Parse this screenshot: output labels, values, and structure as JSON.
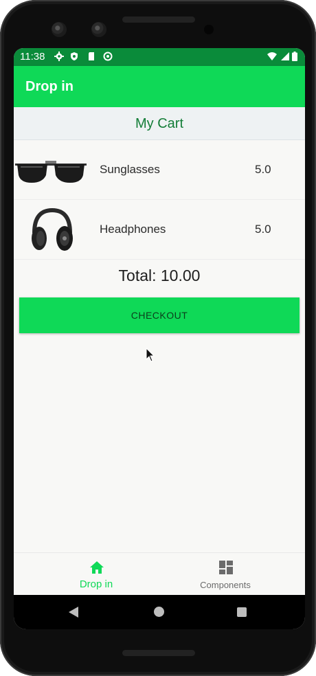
{
  "status_bar": {
    "time": "11:38",
    "icons": [
      "settings-icon",
      "shield-icon",
      "sd-card-icon",
      "at-sign-icon",
      "wifi-icon",
      "signal-icon",
      "battery-icon"
    ]
  },
  "app_bar": {
    "title": "Drop in"
  },
  "cart": {
    "title": "My Cart",
    "items": [
      {
        "name": "Sunglasses",
        "price": "5.0",
        "image_icon": "sunglasses-image"
      },
      {
        "name": "Headphones",
        "price": "5.0",
        "image_icon": "headphones-image"
      }
    ],
    "total_label": "Total: 10.00",
    "checkout_label": "CHECKOUT"
  },
  "bottom_nav": {
    "items": [
      {
        "label": "Drop in",
        "icon": "home-icon",
        "active": true
      },
      {
        "label": "Components",
        "icon": "dashboard-icon",
        "active": false
      }
    ]
  },
  "colors": {
    "status_bar": "#0a8b3a",
    "app_bar": "#0fd957",
    "accent": "#0fd957",
    "cart_title": "#137d37"
  }
}
